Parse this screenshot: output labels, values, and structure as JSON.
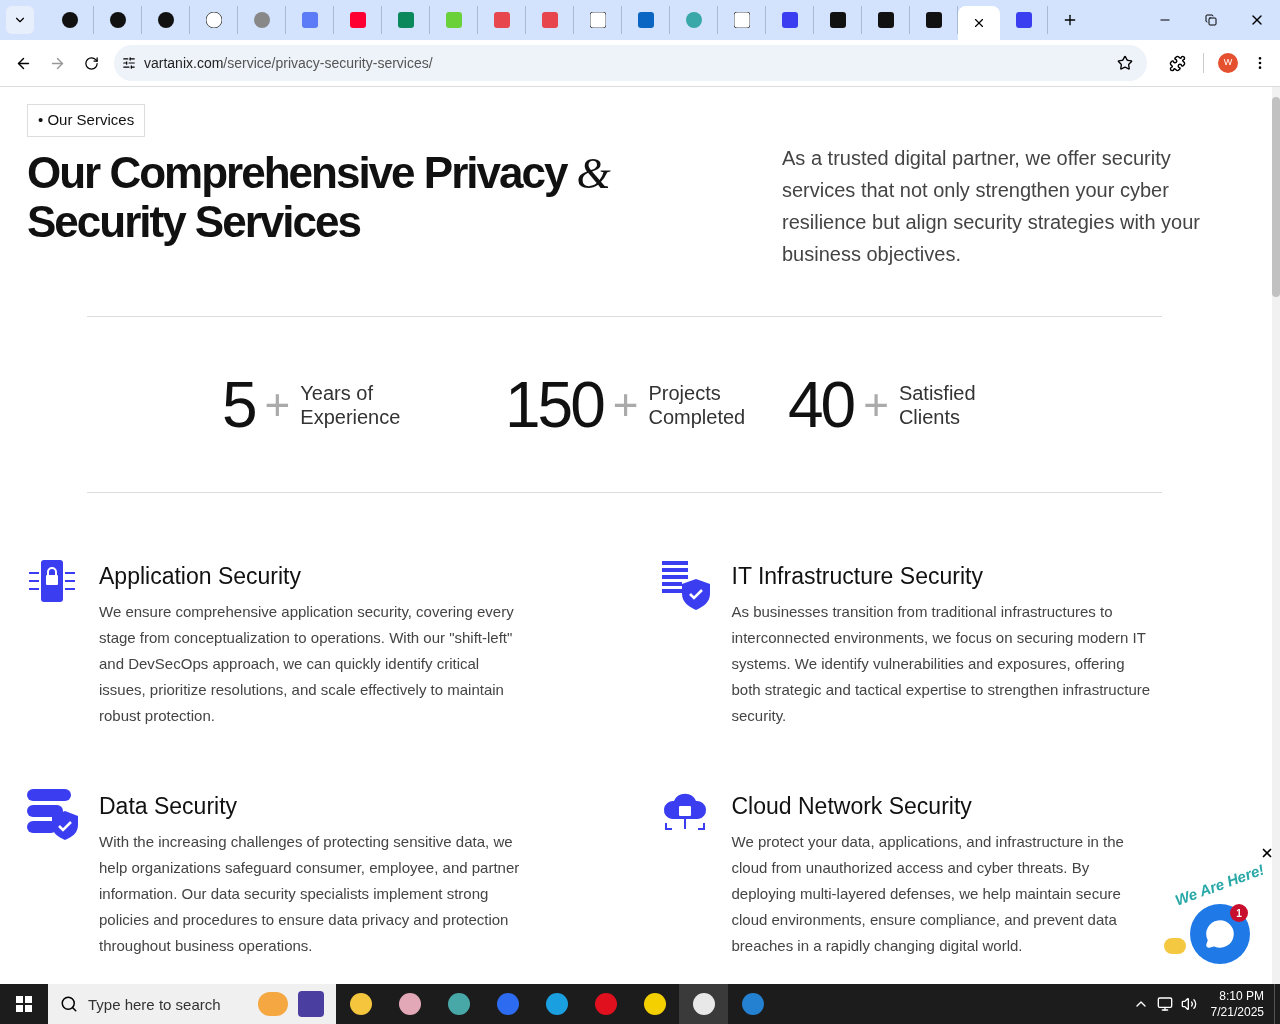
{
  "tabs": [
    {
      "selected": false
    },
    {
      "selected": false
    },
    {
      "selected": false
    },
    {
      "selected": false
    },
    {
      "selected": false
    },
    {
      "selected": false
    },
    {
      "selected": false
    },
    {
      "selected": false
    },
    {
      "selected": false
    },
    {
      "selected": false
    },
    {
      "selected": false
    },
    {
      "selected": false
    },
    {
      "selected": false
    },
    {
      "selected": false
    },
    {
      "selected": false
    },
    {
      "selected": false
    },
    {
      "selected": false
    },
    {
      "selected": false
    },
    {
      "selected": false
    },
    {
      "selected": true
    },
    {
      "selected": false
    }
  ],
  "address_bar": {
    "host": "vartanix.com",
    "path": "/service/privacy-security-services/"
  },
  "profile": {
    "initial": "W"
  },
  "page": {
    "badge_bullet": "•",
    "badge": "Our Services",
    "heading_main": "Our Comprehensive Privacy",
    "heading_amp": "&",
    "heading_line2": "Security Services",
    "intro": "As a trusted digital partner, we offer security services that not only strengthen your cyber resilience but align security strategies with your business objectives.",
    "stats": [
      {
        "number": "5",
        "plus": "+",
        "label": "Years of Experience"
      },
      {
        "number": "150",
        "plus": "+",
        "label": "Projects Completed"
      },
      {
        "number": "40",
        "plus": "+",
        "label": "Satisfied Clients"
      }
    ],
    "services": [
      {
        "title": "Application Security",
        "text": "We ensure comprehensive application security, covering every stage from conceptualization to operations. With our \"shift-left\" and DevSecOps approach, we can quickly identify critical issues, prioritize resolutions, and scale effectively to maintain robust protection."
      },
      {
        "title": "IT Infrastructure Security",
        "text": "As businesses transition from traditional infrastructures to interconnected environments, we focus on securing modern IT systems. We identify vulnerabilities and exposures, offering both strategic and tactical expertise to strengthen infrastructure security."
      },
      {
        "title": "Data Security",
        "text": "With the increasing challenges of protecting sensitive data, we help organizations safeguard consumer, employee, and partner information. Our data security specialists implement strong policies and procedures to ensure data privacy and protection throughout business operations."
      },
      {
        "title": "Cloud Network Security",
        "text": "We protect your data, applications, and infrastructure in the cloud from unauthorized access and cyber threats. By deploying multi-layered defenses, we help maintain secure cloud environments, ensure compliance, and prevent data breaches in a rapidly changing digital world."
      }
    ]
  },
  "chat_widget": {
    "banner": "We Are Here!",
    "unread": "1"
  },
  "taskbar": {
    "search_placeholder": "Type here to search",
    "time": "8:10 PM",
    "date": "7/21/2025"
  }
}
